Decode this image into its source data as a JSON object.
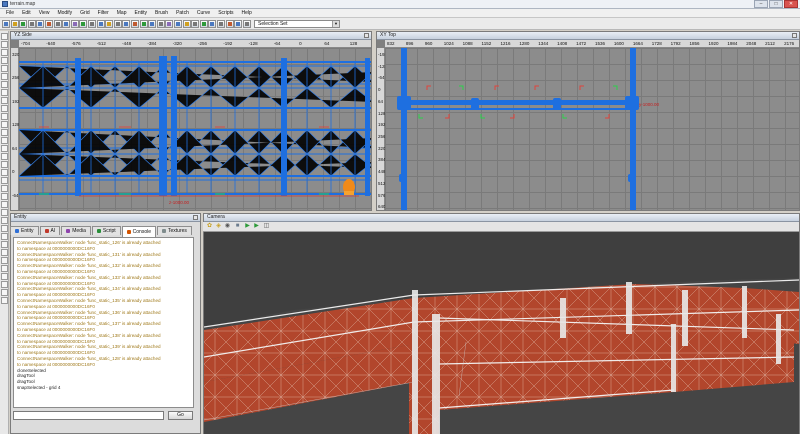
{
  "window": {
    "title": "terrain.map"
  },
  "menu": [
    "File",
    "Edit",
    "View",
    "Modify",
    "Grid",
    "Filter",
    "Map",
    "Entity",
    "Brush",
    "Patch",
    "Curve",
    "Scripts",
    "Help"
  ],
  "toolbar": {
    "selection_set": "Selection Set"
  },
  "yz_view": {
    "title": "YZ Side",
    "ruler_top": [
      "-704",
      "-640",
      "-576",
      "-512",
      "-448",
      "-384",
      "-320",
      "-256",
      "-192",
      "-128",
      "-64",
      "0",
      "64",
      "128"
    ],
    "ruler_left": [
      "320",
      "256",
      "192",
      "128",
      "64",
      "0",
      "-64"
    ],
    "readout": "z-1000.00"
  },
  "xy_view": {
    "title": "XY Top",
    "ruler_top": [
      "832",
      "896",
      "960",
      "1024",
      "1088",
      "1152",
      "1216",
      "1280",
      "1344",
      "1408",
      "1472",
      "1536",
      "1600",
      "1664",
      "1728",
      "1792",
      "1856",
      "1920",
      "1984",
      "2048",
      "2112",
      "2176"
    ],
    "ruler_left": [
      "-192",
      "-128",
      "-64",
      "0",
      "64",
      "128",
      "192",
      "256",
      "320",
      "384",
      "448",
      "512",
      "576",
      "640"
    ],
    "readout": "y-1000.00"
  },
  "entity_panel": {
    "title": "Entity",
    "tabs": [
      "Entity",
      "AI",
      "Media",
      "Script",
      "Console",
      "Textures"
    ],
    "active_tab": "Console",
    "tab_colors": [
      "#2f6fd6",
      "#c0392b",
      "#8e44ad",
      "#2a8f3a",
      "#d35400",
      "#7f8c8d"
    ],
    "console_lines": [
      {
        "text": "ConnectNamespaceWalker: node 'func_static_126' is already attached",
        "kind": "w"
      },
      {
        "text": "to namespace at 0000000000DC16F0",
        "kind": "w"
      },
      {
        "text": "ConnectNamespaceWalker: node 'func_static_131' is already attached",
        "kind": "w"
      },
      {
        "text": "to namespace at 0000000000DC16F0",
        "kind": "w"
      },
      {
        "text": "ConnectNamespaceWalker: node 'func_static_132' is already attached",
        "kind": "w"
      },
      {
        "text": "to namespace at 0000000000DC16F0",
        "kind": "w"
      },
      {
        "text": "ConnectNamespaceWalker: node 'func_static_133' is already attached",
        "kind": "w"
      },
      {
        "text": "to namespace at 0000000000DC16F0",
        "kind": "w"
      },
      {
        "text": "ConnectNamespaceWalker: node 'func_static_134' is already attached",
        "kind": "w"
      },
      {
        "text": "to namespace at 0000000000DC16F0",
        "kind": "w"
      },
      {
        "text": "ConnectNamespaceWalker: node 'func_static_135' is already attached",
        "kind": "w"
      },
      {
        "text": "to namespace at 0000000000DC16F0",
        "kind": "w"
      },
      {
        "text": "ConnectNamespaceWalker: node 'func_static_136' is already attached",
        "kind": "w"
      },
      {
        "text": "to namespace at 0000000000DC16F0",
        "kind": "w"
      },
      {
        "text": "ConnectNamespaceWalker: node 'func_static_137' is already attached",
        "kind": "w"
      },
      {
        "text": "to namespace at 0000000000DC16F0",
        "kind": "w"
      },
      {
        "text": "ConnectNamespaceWalker: node 'func_static_138' is already attached",
        "kind": "w"
      },
      {
        "text": "to namespace at 0000000000DC16F0",
        "kind": "w"
      },
      {
        "text": "ConnectNamespaceWalker: node 'func_static_139' is already attached",
        "kind": "w"
      },
      {
        "text": "to namespace at 0000000000DC16F0",
        "kind": "w"
      },
      {
        "text": "ConnectNamespaceWalker: node 'func_static_128' is already attached",
        "kind": "w"
      },
      {
        "text": "to namespace at 0000000000DC16F0",
        "kind": "w"
      },
      {
        "text": "cloneSelected",
        "kind": "n"
      },
      {
        "text": "dragTool",
        "kind": "n"
      },
      {
        "text": "dragTool",
        "kind": "n"
      },
      {
        "text": "snapSelected - grid 4",
        "kind": "n"
      }
    ],
    "go_label": "Go"
  },
  "camera": {
    "title": "Camera"
  },
  "colors": {
    "brush_blue": "#1e6fe0",
    "wall_red": "#b2462c",
    "floor_gray": "#3f3f3f",
    "entity_orange": "#f08a1a"
  }
}
